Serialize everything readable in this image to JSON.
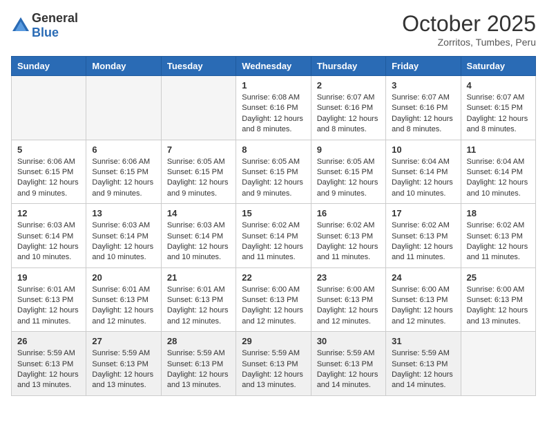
{
  "header": {
    "logo_general": "General",
    "logo_blue": "Blue",
    "month_title": "October 2025",
    "subtitle": "Zorritos, Tumbes, Peru"
  },
  "days_of_week": [
    "Sunday",
    "Monday",
    "Tuesday",
    "Wednesday",
    "Thursday",
    "Friday",
    "Saturday"
  ],
  "weeks": [
    [
      {
        "day": "",
        "empty": true
      },
      {
        "day": "",
        "empty": true
      },
      {
        "day": "",
        "empty": true
      },
      {
        "day": "1",
        "sunrise": "6:08 AM",
        "sunset": "6:16 PM",
        "daylight": "12 hours and 8 minutes."
      },
      {
        "day": "2",
        "sunrise": "6:07 AM",
        "sunset": "6:16 PM",
        "daylight": "12 hours and 8 minutes."
      },
      {
        "day": "3",
        "sunrise": "6:07 AM",
        "sunset": "6:16 PM",
        "daylight": "12 hours and 8 minutes."
      },
      {
        "day": "4",
        "sunrise": "6:07 AM",
        "sunset": "6:15 PM",
        "daylight": "12 hours and 8 minutes."
      }
    ],
    [
      {
        "day": "5",
        "sunrise": "6:06 AM",
        "sunset": "6:15 PM",
        "daylight": "12 hours and 9 minutes."
      },
      {
        "day": "6",
        "sunrise": "6:06 AM",
        "sunset": "6:15 PM",
        "daylight": "12 hours and 9 minutes."
      },
      {
        "day": "7",
        "sunrise": "6:05 AM",
        "sunset": "6:15 PM",
        "daylight": "12 hours and 9 minutes."
      },
      {
        "day": "8",
        "sunrise": "6:05 AM",
        "sunset": "6:15 PM",
        "daylight": "12 hours and 9 minutes."
      },
      {
        "day": "9",
        "sunrise": "6:05 AM",
        "sunset": "6:15 PM",
        "daylight": "12 hours and 9 minutes."
      },
      {
        "day": "10",
        "sunrise": "6:04 AM",
        "sunset": "6:14 PM",
        "daylight": "12 hours and 10 minutes."
      },
      {
        "day": "11",
        "sunrise": "6:04 AM",
        "sunset": "6:14 PM",
        "daylight": "12 hours and 10 minutes."
      }
    ],
    [
      {
        "day": "12",
        "sunrise": "6:03 AM",
        "sunset": "6:14 PM",
        "daylight": "12 hours and 10 minutes."
      },
      {
        "day": "13",
        "sunrise": "6:03 AM",
        "sunset": "6:14 PM",
        "daylight": "12 hours and 10 minutes."
      },
      {
        "day": "14",
        "sunrise": "6:03 AM",
        "sunset": "6:14 PM",
        "daylight": "12 hours and 10 minutes."
      },
      {
        "day": "15",
        "sunrise": "6:02 AM",
        "sunset": "6:14 PM",
        "daylight": "12 hours and 11 minutes."
      },
      {
        "day": "16",
        "sunrise": "6:02 AM",
        "sunset": "6:13 PM",
        "daylight": "12 hours and 11 minutes."
      },
      {
        "day": "17",
        "sunrise": "6:02 AM",
        "sunset": "6:13 PM",
        "daylight": "12 hours and 11 minutes."
      },
      {
        "day": "18",
        "sunrise": "6:02 AM",
        "sunset": "6:13 PM",
        "daylight": "12 hours and 11 minutes."
      }
    ],
    [
      {
        "day": "19",
        "sunrise": "6:01 AM",
        "sunset": "6:13 PM",
        "daylight": "12 hours and 11 minutes."
      },
      {
        "day": "20",
        "sunrise": "6:01 AM",
        "sunset": "6:13 PM",
        "daylight": "12 hours and 12 minutes."
      },
      {
        "day": "21",
        "sunrise": "6:01 AM",
        "sunset": "6:13 PM",
        "daylight": "12 hours and 12 minutes."
      },
      {
        "day": "22",
        "sunrise": "6:00 AM",
        "sunset": "6:13 PM",
        "daylight": "12 hours and 12 minutes."
      },
      {
        "day": "23",
        "sunrise": "6:00 AM",
        "sunset": "6:13 PM",
        "daylight": "12 hours and 12 minutes."
      },
      {
        "day": "24",
        "sunrise": "6:00 AM",
        "sunset": "6:13 PM",
        "daylight": "12 hours and 12 minutes."
      },
      {
        "day": "25",
        "sunrise": "6:00 AM",
        "sunset": "6:13 PM",
        "daylight": "12 hours and 13 minutes."
      }
    ],
    [
      {
        "day": "26",
        "sunrise": "5:59 AM",
        "sunset": "6:13 PM",
        "daylight": "12 hours and 13 minutes."
      },
      {
        "day": "27",
        "sunrise": "5:59 AM",
        "sunset": "6:13 PM",
        "daylight": "12 hours and 13 minutes."
      },
      {
        "day": "28",
        "sunrise": "5:59 AM",
        "sunset": "6:13 PM",
        "daylight": "12 hours and 13 minutes."
      },
      {
        "day": "29",
        "sunrise": "5:59 AM",
        "sunset": "6:13 PM",
        "daylight": "12 hours and 13 minutes."
      },
      {
        "day": "30",
        "sunrise": "5:59 AM",
        "sunset": "6:13 PM",
        "daylight": "12 hours and 14 minutes."
      },
      {
        "day": "31",
        "sunrise": "5:59 AM",
        "sunset": "6:13 PM",
        "daylight": "12 hours and 14 minutes."
      },
      {
        "day": "",
        "empty": true
      }
    ]
  ],
  "labels": {
    "sunrise_label": "Sunrise:",
    "sunset_label": "Sunset:",
    "daylight_label": "Daylight:"
  }
}
